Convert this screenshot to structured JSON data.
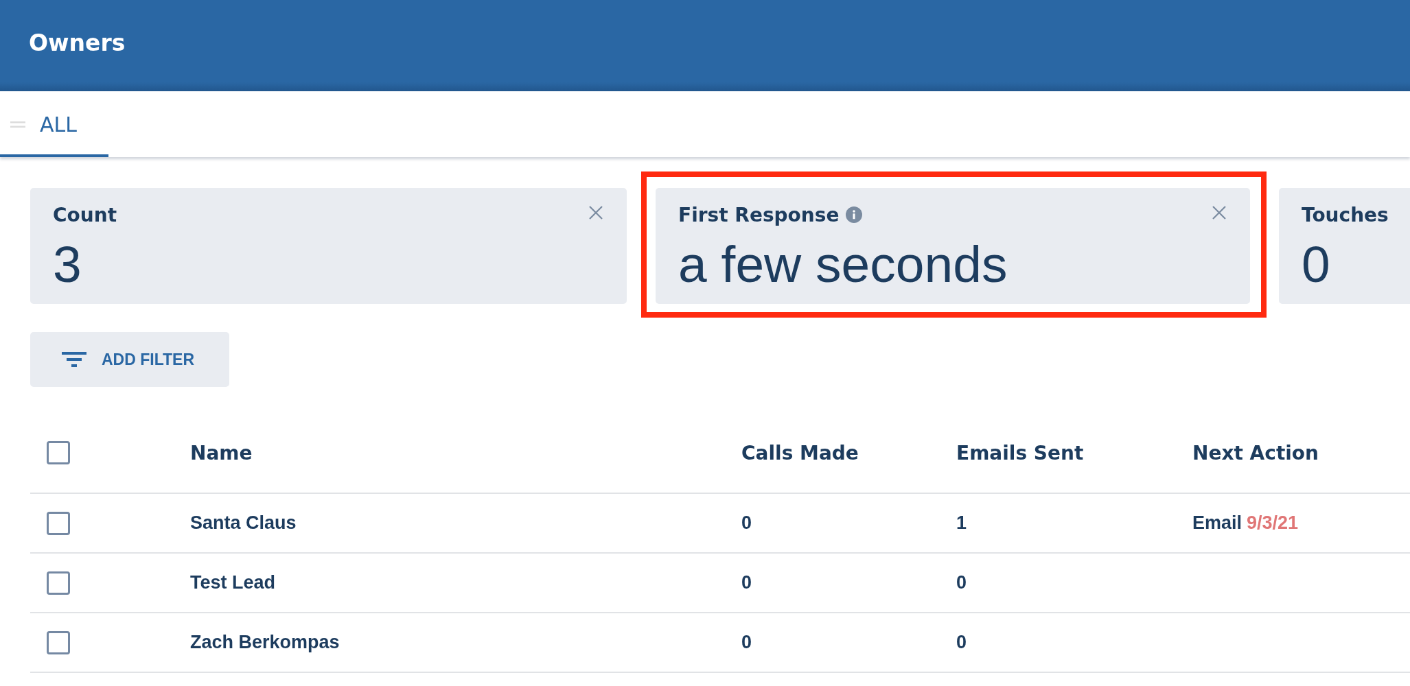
{
  "header": {
    "title": "Owners"
  },
  "tabs": [
    {
      "label": "ALL",
      "selected": true
    }
  ],
  "metrics": [
    {
      "label": "Count",
      "value": "3",
      "info": false,
      "closable": true,
      "highlighted": false
    },
    {
      "label": "First Response",
      "value": "a few seconds",
      "info": true,
      "closable": true,
      "highlighted": true
    },
    {
      "label": "Touches",
      "value": "0",
      "info": false,
      "closable": false,
      "highlighted": false
    }
  ],
  "filter_button": {
    "label": "ADD FILTER"
  },
  "table": {
    "select_all": {
      "checked": false
    },
    "columns": [
      "Name",
      "Calls Made",
      "Emails Sent",
      "Next Action"
    ],
    "rows": [
      {
        "checked": false,
        "name": "Santa Claus",
        "calls_made": "0",
        "emails_sent": "1",
        "next_action": {
          "label": "Email",
          "date": "9/3/21",
          "overdue": true
        }
      },
      {
        "checked": false,
        "name": "Test Lead",
        "calls_made": "0",
        "emails_sent": "0"
      },
      {
        "checked": false,
        "name": "Zach Berkompas",
        "calls_made": "0",
        "emails_sent": "0"
      }
    ]
  }
}
